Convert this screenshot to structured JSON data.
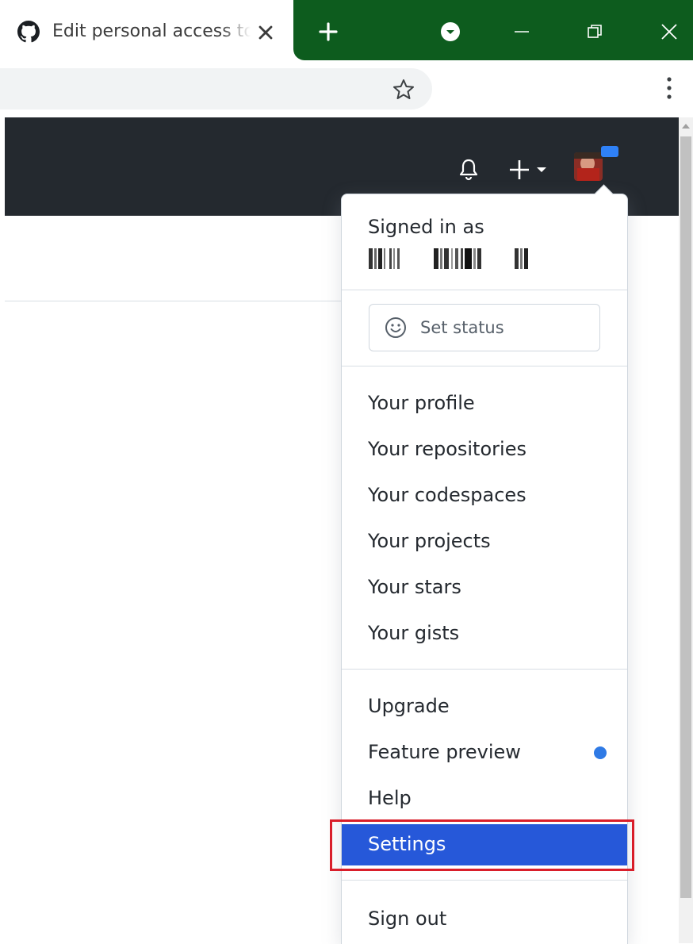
{
  "browser": {
    "tab_title": "Edit personal access tokens",
    "colors": {
      "tabstrip": "#0d5c1e",
      "omnibox": "#f1f3f4"
    }
  },
  "header": {
    "bg": "#24292f",
    "icons": [
      "bell-icon",
      "plus-icon",
      "avatar"
    ]
  },
  "dropdown": {
    "signed_in_label": "Signed in as",
    "set_status_label": "Set status",
    "group1": [
      "Your profile",
      "Your repositories",
      "Your codespaces",
      "Your projects",
      "Your stars",
      "Your gists"
    ],
    "group2": [
      "Upgrade",
      "Feature preview",
      "Help",
      "Settings"
    ],
    "sign_out": "Sign out",
    "active_item": "Settings",
    "colors": {
      "active_bg": "#2658d9",
      "highlight_border": "#d91e2a",
      "dot": "#2f7ae5"
    }
  }
}
